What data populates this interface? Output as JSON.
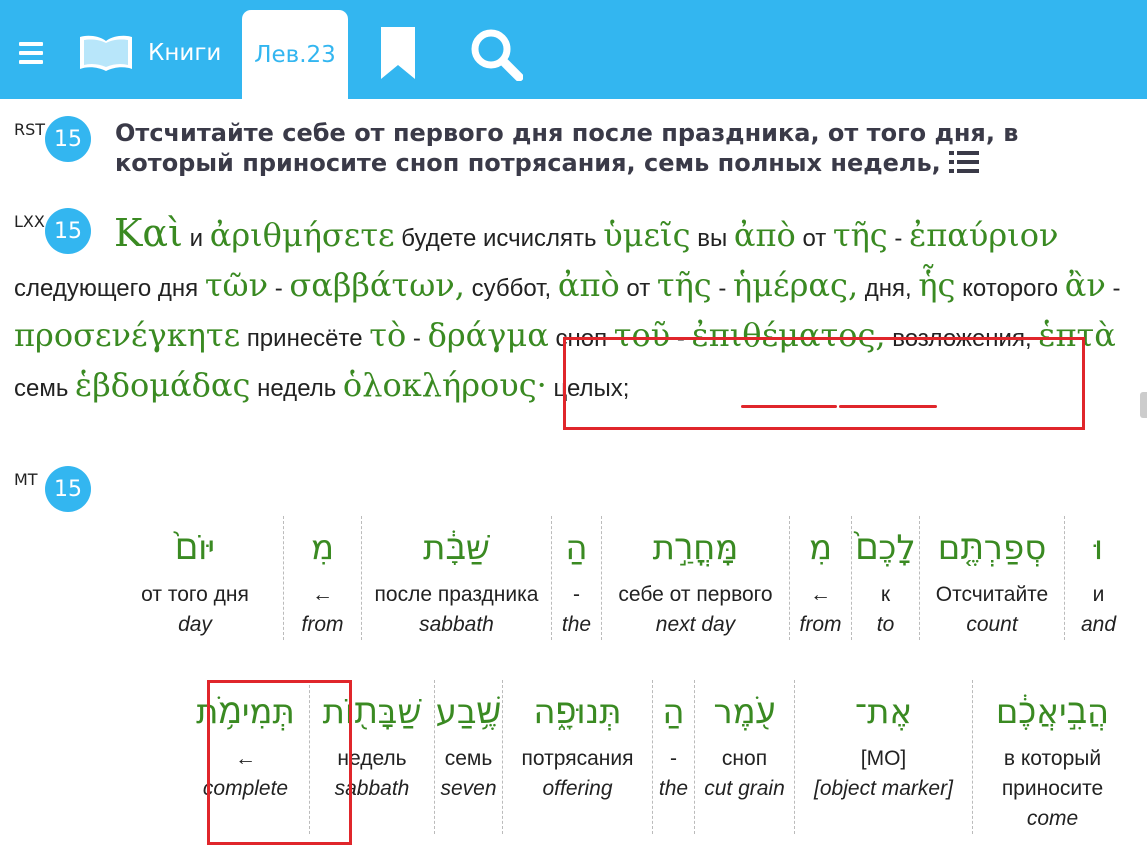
{
  "toolbar": {
    "books_label": "Книги",
    "active_tab": "Лев.23",
    "icons": [
      "menu-icon",
      "book-icon",
      "bookmark-icon",
      "search-icon"
    ],
    "accent_color": "#33b6f0"
  },
  "rst": {
    "tag": "RST",
    "verse": "15",
    "text": "Отсчитайте себе от первого дня после праздника, от того дня, в который приносите сноп потрясания, семь полных недель,"
  },
  "lxx": {
    "tag": "LXX",
    "verse": "15",
    "words": [
      {
        "g": "Καὶ",
        "t": "и"
      },
      {
        "g": "ἀριθμήσετε",
        "t": "будете исчислять"
      },
      {
        "g": "ὑμεῖς",
        "t": "вы"
      },
      {
        "g": "ἀπὸ",
        "t": "от"
      },
      {
        "g": "τῆς",
        "t": "-"
      },
      {
        "g": "ἐπαύριον",
        "t": "следующего дня"
      },
      {
        "g": "τῶν",
        "t": "-"
      },
      {
        "g": "σαββάτων,",
        "t": "суббот,"
      },
      {
        "g": "ἀπὸ",
        "t": "от"
      },
      {
        "g": "τῆς",
        "t": "-"
      },
      {
        "g": "ἡμέρας,",
        "t": "дня,"
      },
      {
        "g": "ἧς",
        "t": "которого"
      },
      {
        "g": "ἂν",
        "t": "-"
      },
      {
        "g": "προσενέγκητε",
        "t": "принесёте"
      },
      {
        "g": "τὸ",
        "t": "-"
      },
      {
        "g": "δράγμα",
        "t": "сноп"
      },
      {
        "g": "τοῦ",
        "t": "-"
      },
      {
        "g": "ἐπιθέματος,",
        "t": "возложения,"
      },
      {
        "g": "ἑπτὰ",
        "t": "семь"
      },
      {
        "g": "ἑβδομάδας",
        "t": "недель"
      },
      {
        "g": "ὁλοκλήρους·",
        "t": "целых;"
      }
    ]
  },
  "mt": {
    "tag": "MT",
    "verse": "15",
    "row1": [
      {
        "heb": "וּ",
        "ru": "и",
        "en": "and"
      },
      {
        "heb": "סְפַרְתֶּ֤ם",
        "ru": "Отсчитайте",
        "en": "count"
      },
      {
        "heb": "לָכֶם֙",
        "ru": "к",
        "en": "to"
      },
      {
        "heb": "מִ",
        "ru": "←",
        "en": "from"
      },
      {
        "heb": "מָּחֳרַ֣ת",
        "ru": "себе от первого",
        "en": "next day"
      },
      {
        "heb": "הַ",
        "ru": "-",
        "en": "the"
      },
      {
        "heb": "שַּׁבָּ֔ת",
        "ru": "после праздника",
        "en": "sabbath"
      },
      {
        "heb": "מִ",
        "ru": "←",
        "en": "from"
      },
      {
        "heb": "יּוֹם֙",
        "ru": "от того дня",
        "en": "day"
      }
    ],
    "row2": [
      {
        "heb": "הֲבִ֣יאֲכֶ֔ם",
        "ru": "в который приносите",
        "en": "come"
      },
      {
        "heb": "אֶת־",
        "ru": "[МО]",
        "en": "[object marker]"
      },
      {
        "heb": "עֹ֖מֶר",
        "ru": "сноп",
        "en": "cut grain"
      },
      {
        "heb": "הַ",
        "ru": "-",
        "en": "the"
      },
      {
        "heb": "תְּנוּפָ֑ה",
        "ru": "потрясания",
        "en": "offering"
      },
      {
        "heb": "שֶׁ֥בַע",
        "ru": "семь",
        "en": "seven"
      },
      {
        "heb": "שַׁבָּת֖וֹת",
        "ru": "недель",
        "en": "sabbath"
      },
      {
        "heb": "תְּמִימֹ֥ת",
        "ru": "←",
        "en": "complete"
      }
    ]
  }
}
